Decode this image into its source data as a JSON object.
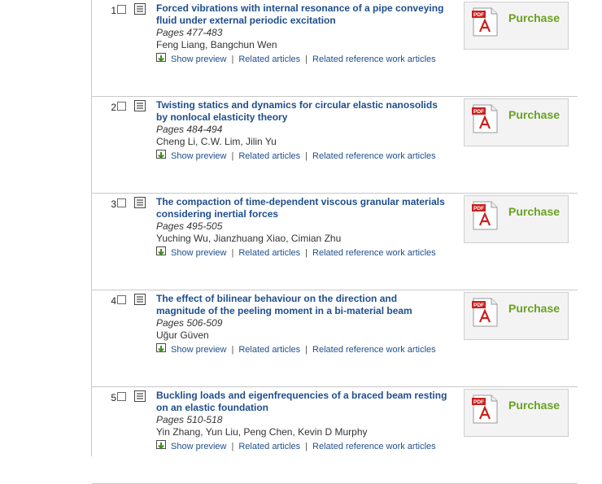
{
  "results": [
    {
      "number": "1",
      "title": "Forced vibrations with internal resonance of a pipe conveying fluid under external periodic excitation",
      "pages": "Pages 477-483",
      "authors": "Feng Liang, Bangchun Wen",
      "show_preview": "Show preview",
      "related_articles": "Related articles",
      "related_reference_work": "Related reference work articles",
      "purchase": "Purchase",
      "pdf_badge": "PDF"
    },
    {
      "number": "2",
      "title": "Twisting statics and dynamics for circular elastic nanosolids by nonlocal elasticity theory",
      "pages": "Pages 484-494",
      "authors": "Cheng Li, C.W. Lim, Jilin Yu",
      "show_preview": "Show preview",
      "related_articles": "Related articles",
      "related_reference_work": "Related reference work articles",
      "purchase": "Purchase",
      "pdf_badge": "PDF"
    },
    {
      "number": "3",
      "title": "The compaction of time-dependent viscous granular materials considering inertial forces",
      "pages": "Pages 495-505",
      "authors": "Yuching Wu, Jianzhuang Xiao, Cimian Zhu",
      "show_preview": "Show preview",
      "related_articles": "Related articles",
      "related_reference_work": "Related reference work articles",
      "purchase": "Purchase",
      "pdf_badge": "PDF"
    },
    {
      "number": "4",
      "title": "The effect of bilinear behaviour on the direction and magnitude of the peeling moment in a bi-material beam",
      "pages": "Pages 506-509",
      "authors": "Uğur Güven",
      "show_preview": "Show preview",
      "related_articles": "Related articles",
      "related_reference_work": "Related reference work articles",
      "purchase": "Purchase",
      "pdf_badge": "PDF"
    },
    {
      "number": "5",
      "title": "Buckling loads and eigenfrequencies of a braced beam resting on an elastic foundation",
      "pages": "Pages 510-518",
      "authors": "Yin Zhang, Yun Liu, Peng Chen, Kevin D Murphy",
      "show_preview": "Show preview",
      "related_articles": "Related articles",
      "related_reference_work": "Related reference work articles",
      "purchase": "Purchase",
      "pdf_badge": "PDF"
    }
  ],
  "icons": {
    "abstract": "abstract-list-icon",
    "preview": "preview-arrow-icon",
    "pdf": "pdf-adobe-icon"
  },
  "colors": {
    "title_link": "#1f4e8c",
    "purchase": "#6aa121",
    "pdf_red": "#c8211f"
  }
}
